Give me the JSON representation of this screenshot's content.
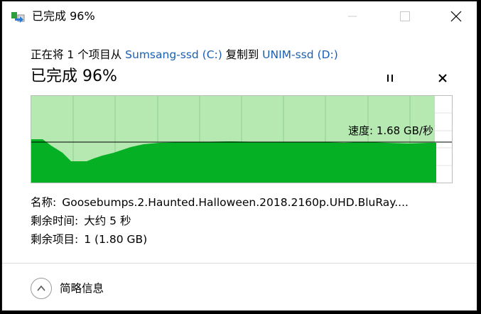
{
  "window": {
    "title": "已完成 96%",
    "app_icon": "file-copy-icon",
    "controls": {
      "minimize_icon": "minimize-icon",
      "maximize_icon": "maximize-icon",
      "close_icon": "close-icon"
    }
  },
  "copy": {
    "prefix": "正在将 1 个项目从 ",
    "source": "Sumsang-ssd (C:)",
    "middle": " 复制到 ",
    "destination": "UNIM-ssd (D:)"
  },
  "status": {
    "text": "已完成 96%",
    "progress_percent": 96
  },
  "controls": {
    "pause_icon": "pause-icon",
    "cancel_icon": "cancel-icon"
  },
  "graph": {
    "speed_label": "速度: 1.68 GB/秒",
    "colors": {
      "fill_done": "#b6e9b2",
      "speed_area": "#06b025",
      "grid": "#8fd089"
    }
  },
  "details": {
    "name_label": "名称:",
    "name_value": "Goosebumps.2.Haunted.Halloween.2018.2160p.UHD.BluRay....",
    "time_label": "剩余时间:",
    "time_value": "大约 5 秒",
    "items_label": "剩余项目:",
    "items_value": "1 (1.80 GB)"
  },
  "footer": {
    "toggle_icon": "chevron-up-icon",
    "label": "简略信息"
  }
}
